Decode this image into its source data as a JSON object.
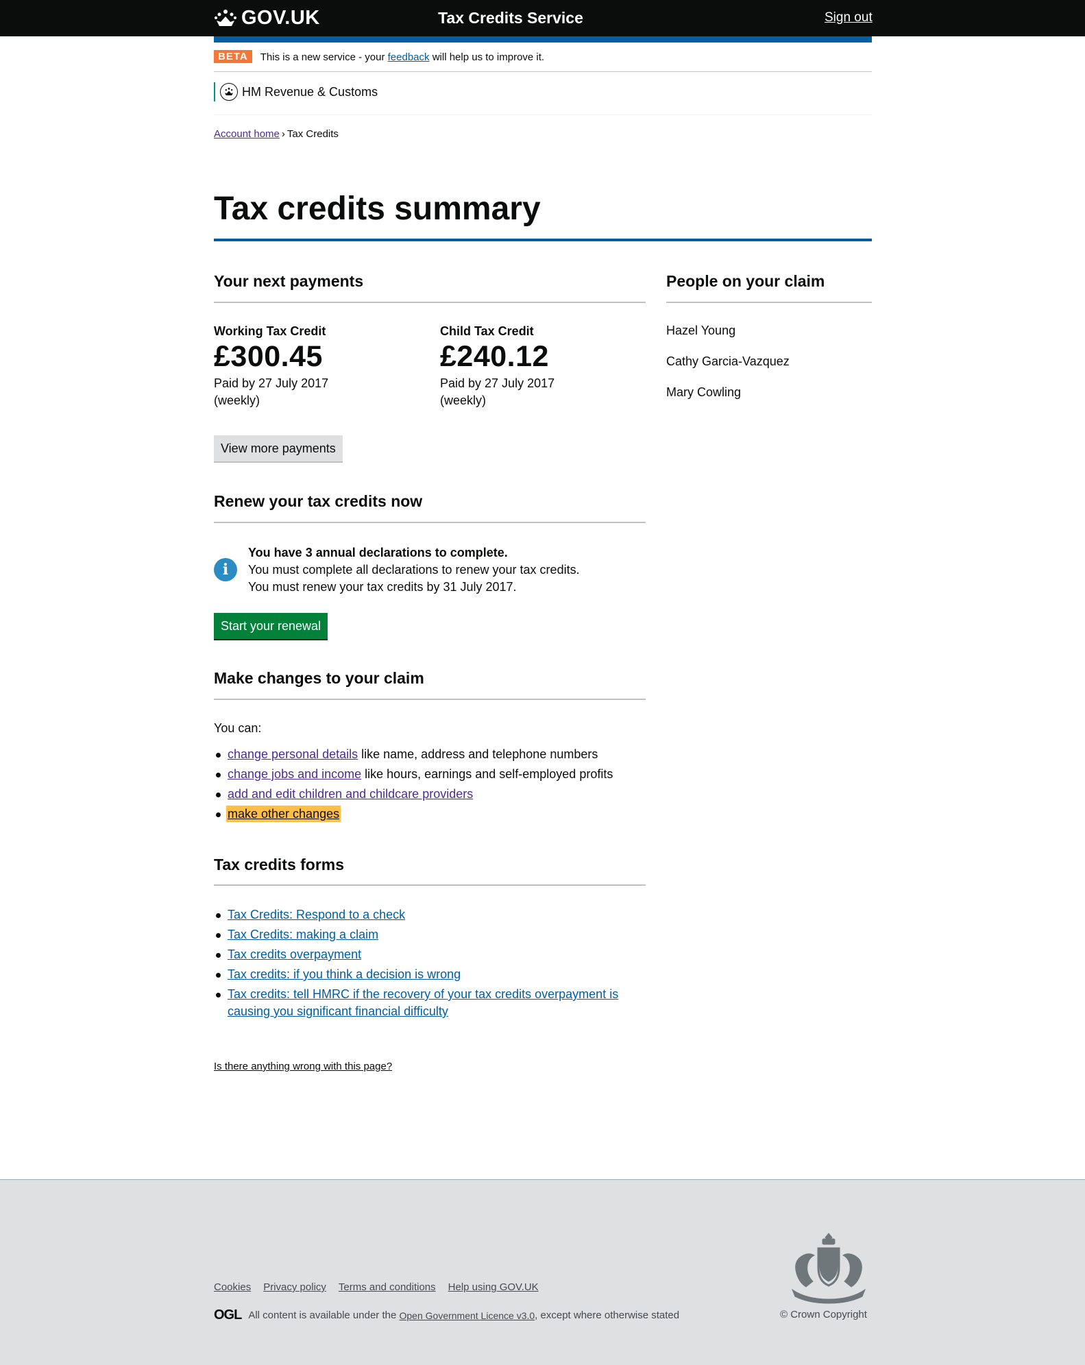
{
  "header": {
    "logo_text": "GOV.UK",
    "service_name": "Tax Credits Service",
    "sign_out": "Sign out"
  },
  "phase_banner": {
    "tag": "BETA",
    "text_before": "This is a new service - your",
    "feedback_link": "feedback",
    "text_after": "will help us to improve it."
  },
  "department": {
    "name": "HM Revenue & Customs"
  },
  "breadcrumb": {
    "home": "Account home",
    "separator": "›",
    "current": "Tax Credits"
  },
  "page_title": "Tax credits summary",
  "payments": {
    "heading": "Your next payments",
    "items": [
      {
        "label": "Working Tax Credit",
        "amount": "£300.45",
        "date": "Paid by 27 July 2017",
        "frequency": "(weekly)"
      },
      {
        "label": "Child Tax Credit",
        "amount": "£240.12",
        "date": "Paid by 27 July 2017",
        "frequency": "(weekly)"
      }
    ],
    "view_more_button": "View more payments"
  },
  "people": {
    "heading": "People on your claim",
    "names": [
      "Hazel Young",
      "Cathy Garcia-Vazquez",
      "Mary Cowling"
    ]
  },
  "renewal": {
    "heading": "Renew your tax credits now",
    "notice_strong": "You have 3 annual declarations to complete.",
    "notice_line2": "You must complete all declarations to renew your tax credits.",
    "notice_line3": "You must renew your tax credits by 31 July 2017.",
    "start_button": "Start your renewal"
  },
  "changes": {
    "heading": "Make changes to your claim",
    "intro": "You can:",
    "items": [
      {
        "link": "change personal details",
        "text": " like name, address and telephone numbers"
      },
      {
        "link": "change jobs and income",
        "text": " like hours, earnings and self-employed profits"
      },
      {
        "link": "add and edit children and childcare providers",
        "text": ""
      },
      {
        "link": "make other changes",
        "text": ""
      }
    ]
  },
  "forms": {
    "heading": "Tax credits forms",
    "items": [
      "Tax Credits: Respond to a check",
      "Tax Credits: making a claim",
      "Tax credits overpayment",
      "Tax credits: if you think a decision is wrong",
      "Tax credits: tell HMRC if the recovery of your tax credits overpayment is causing you significant financial difficulty"
    ]
  },
  "report_link": "Is there anything wrong with this page?",
  "footer": {
    "links": [
      "Cookies",
      "Privacy policy",
      "Terms and conditions",
      "Help using GOV.UK"
    ],
    "ogl_logo": "OGL",
    "licence_before": "All content is available under the",
    "licence_link": "Open Government Licence v3.0",
    "licence_after": ", except where otherwise stated",
    "copyright": "© Crown Copyright"
  },
  "colors": {
    "header_bg": "#0b0c0c",
    "brand_blue": "#005ea5",
    "beta_orange": "#f47738",
    "button_green": "#00823b",
    "focus_yellow": "#ffbf47",
    "info_blue": "#2b8cc4",
    "footer_bg": "#dee0e2"
  }
}
